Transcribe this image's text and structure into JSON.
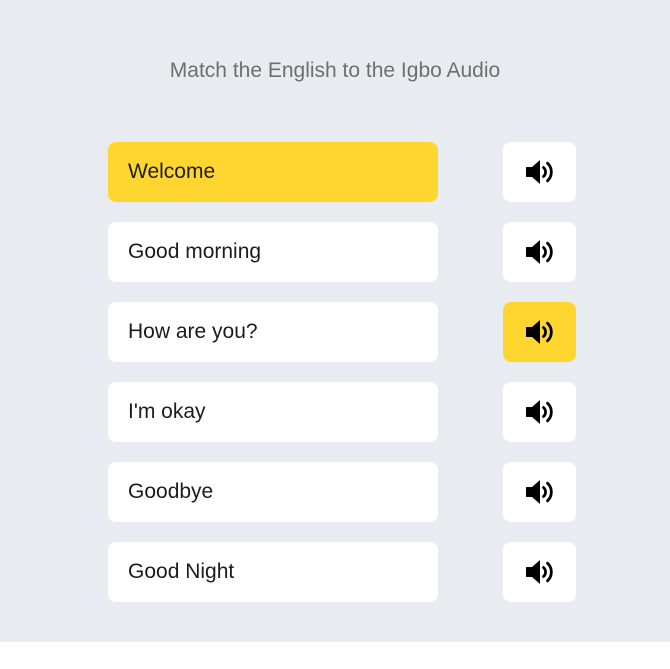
{
  "prompt": "Match the English to the Igbo Audio",
  "colors": {
    "background": "#e8ebef",
    "card": "#ffffff",
    "selected": "#ffd630",
    "prompt_text": "#6f6f6f",
    "phrase_text": "#1c1c1c"
  },
  "phrases": [
    {
      "label": "Welcome",
      "selected": true
    },
    {
      "label": "Good morning",
      "selected": false
    },
    {
      "label": "How are you?",
      "selected": false
    },
    {
      "label": "I'm okay",
      "selected": false
    },
    {
      "label": "Goodbye",
      "selected": false
    },
    {
      "label": "Good Night",
      "selected": false
    }
  ],
  "audio_buttons": [
    {
      "icon": "speaker-icon",
      "selected": false
    },
    {
      "icon": "speaker-icon",
      "selected": false
    },
    {
      "icon": "speaker-icon",
      "selected": true
    },
    {
      "icon": "speaker-icon",
      "selected": false
    },
    {
      "icon": "speaker-icon",
      "selected": false
    },
    {
      "icon": "speaker-icon",
      "selected": false
    }
  ]
}
